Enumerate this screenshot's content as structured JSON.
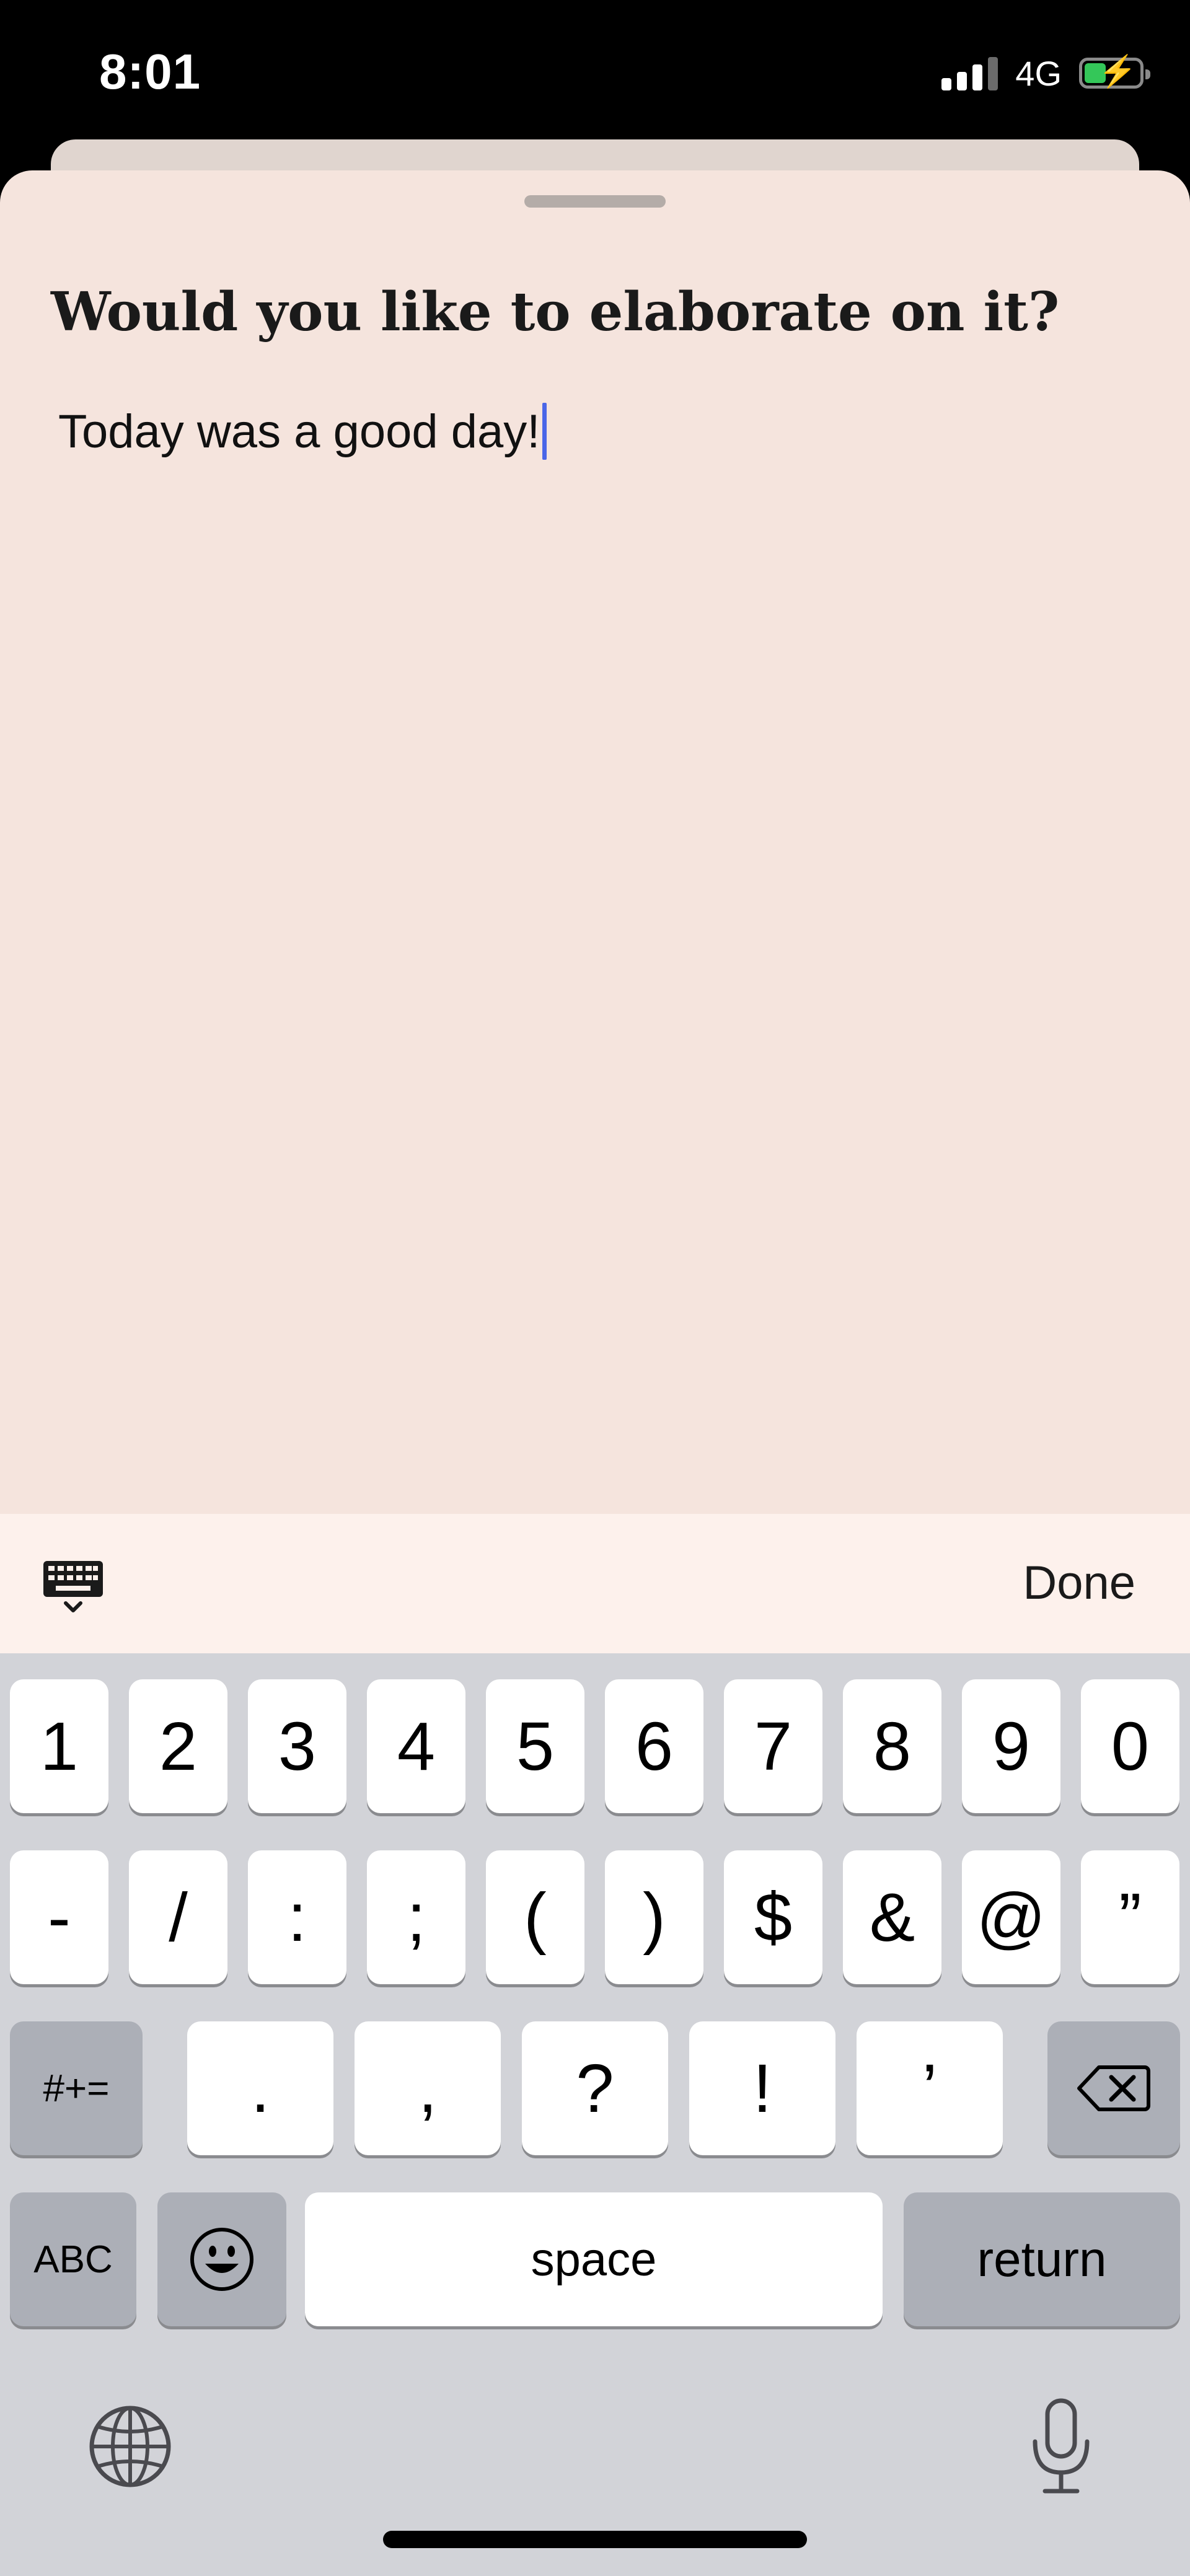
{
  "status_bar": {
    "time": "8:01",
    "network": "4G",
    "signal_bars_active": 3,
    "signal_bars_total": 4,
    "battery_state": "charging"
  },
  "sheet": {
    "title": "Would you like to elaborate on it?",
    "entry_text": "Today was a good day!",
    "background_color": "#f5e4dd"
  },
  "accessory_bar": {
    "done_label": "Done",
    "dismiss_icon": "keyboard-dismiss-icon"
  },
  "keyboard": {
    "row1": [
      "1",
      "2",
      "3",
      "4",
      "5",
      "6",
      "7",
      "8",
      "9",
      "0"
    ],
    "row2": [
      "-",
      "/",
      ":",
      ";",
      "(",
      ")",
      "$",
      "&",
      "@",
      "”"
    ],
    "row3": {
      "mode_key": "#+=",
      "keys": [
        ".",
        ",",
        "?",
        "!",
        "’"
      ],
      "delete_icon": "delete-icon"
    },
    "row4": {
      "abc_key": "ABC",
      "emoji_icon": "emoji-icon",
      "space_label": "space",
      "return_label": "return"
    },
    "globe_icon": "globe-icon",
    "mic_icon": "microphone-icon"
  },
  "colors": {
    "caret": "#4a66e8",
    "keyboard_bg": "#d2d3d8",
    "key_bg": "#ffffff",
    "special_key_bg": "#acafb7",
    "battery_fill": "#34c759"
  }
}
